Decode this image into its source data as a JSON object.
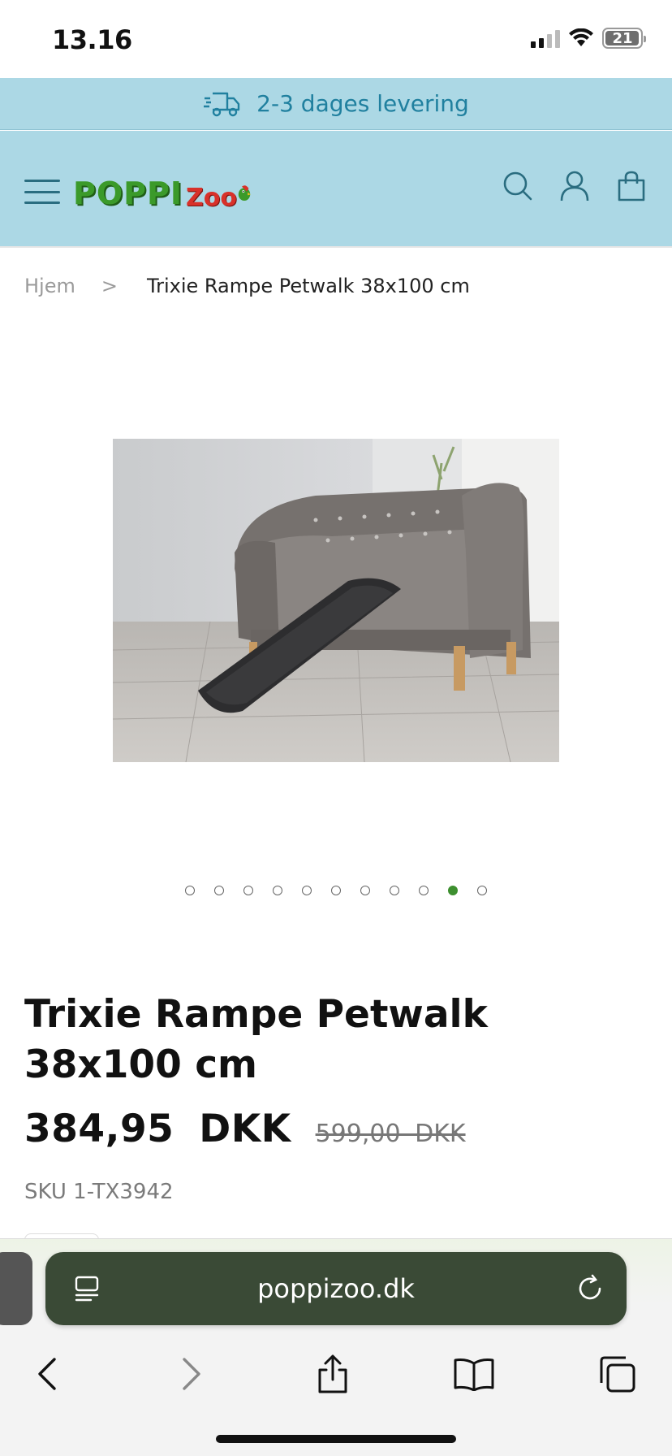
{
  "status_bar": {
    "time": "13.16",
    "battery_level": "21",
    "battery_fraction": 0.21
  },
  "delivery_banner": {
    "text": "2-3 dages levering",
    "icon": "delivery-truck-icon"
  },
  "header": {
    "logo_part1": "POPPI",
    "logo_part2": "Zoo",
    "icons": [
      "menu-icon",
      "search-icon",
      "account-icon",
      "cart-icon"
    ]
  },
  "breadcrumb": {
    "home": "Hjem",
    "separator": ">",
    "current": "Trixie Rampe Petwalk 38x100 cm"
  },
  "gallery": {
    "dot_count": 11,
    "active_index": 9
  },
  "product": {
    "title": "Trixie Rampe Petwalk 38x100 cm",
    "price": "384,95 DKK",
    "old_price": "599,00 DKK",
    "sku": "SKU 1-TX3942"
  },
  "browser": {
    "url": "poppizoo.dk",
    "toolbar_icons": [
      "back-icon",
      "forward-icon",
      "share-icon",
      "bookmarks-icon",
      "tabs-icon"
    ]
  },
  "colors": {
    "banner_bg": "#acd8e5",
    "banner_text": "#20809f",
    "accent_green": "#3d8f2f"
  }
}
